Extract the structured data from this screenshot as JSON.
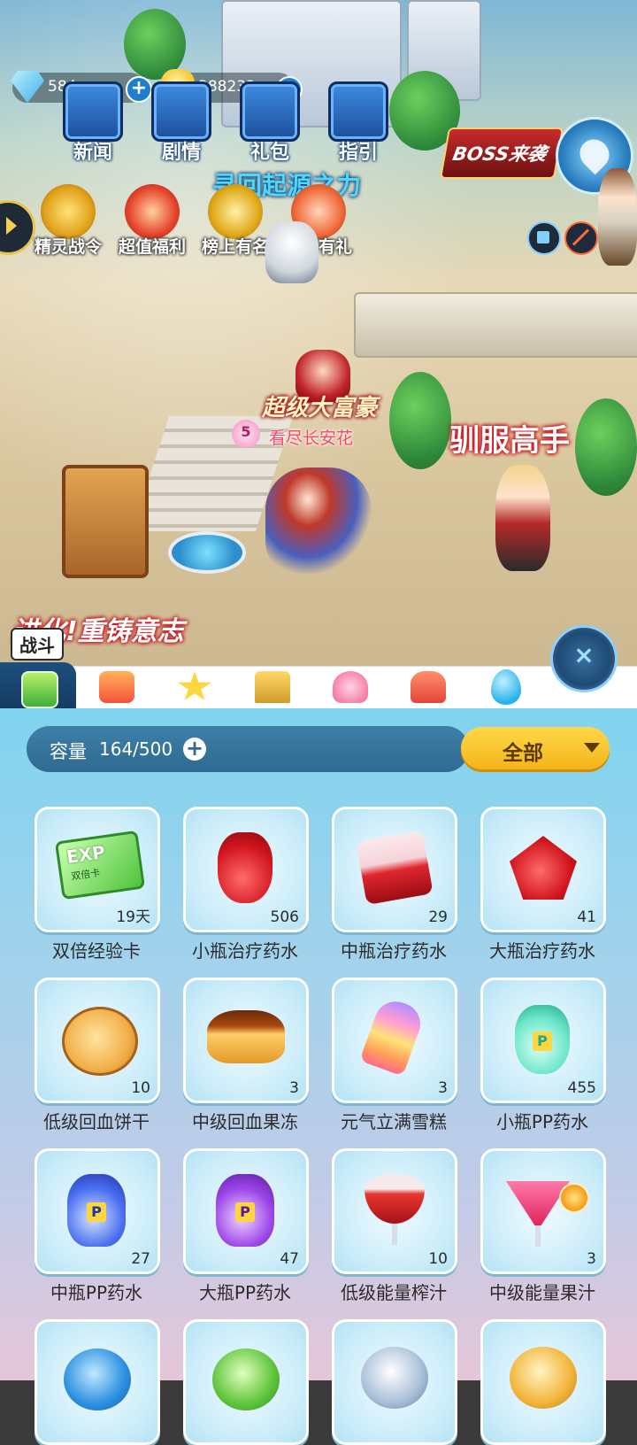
{
  "hud": {
    "gems": "584",
    "coins": "388232",
    "top_buttons": [
      {
        "label": "新闻"
      },
      {
        "label": "剧情"
      },
      {
        "label": "礼包"
      },
      {
        "label": "指引"
      }
    ],
    "event_buttons": [
      {
        "label": "精灵战令"
      },
      {
        "label": "超值福利"
      },
      {
        "label": "榜上有名"
      },
      {
        "label": "邀请有礼"
      }
    ],
    "boss_label": "BOSS来袭",
    "event_banner": "寻回起源之力"
  },
  "scene": {
    "player_title": "超级大富豪",
    "player_name": "看尽长安花",
    "player_level": "5",
    "tamer_banner": "驯服高手",
    "evolve_banner": "进化!重铸意志"
  },
  "tabs": {
    "active_label": "战斗"
  },
  "bag": {
    "capacity_label": "容量",
    "capacity_value": "164/500",
    "filter_label": "全部",
    "items": [
      {
        "name": "双倍经验卡",
        "count": "19天",
        "art": "exp-card",
        "art_text": "EXP",
        "art_sub": "双倍卡"
      },
      {
        "name": "小瓶治疗药水",
        "count": "506",
        "art": "potion-small-red"
      },
      {
        "name": "中瓶治疗药水",
        "count": "29",
        "art": "potion-medium-red"
      },
      {
        "name": "大瓶治疗药水",
        "count": "41",
        "art": "potion-large-red"
      },
      {
        "name": "低级回血饼干",
        "count": "10",
        "art": "cookie"
      },
      {
        "name": "中级回血果冻",
        "count": "3",
        "art": "pudding"
      },
      {
        "name": "元气立满雪糕",
        "count": "3",
        "art": "popsicle"
      },
      {
        "name": "小瓶PP药水",
        "count": "455",
        "art": "pp-potion-small",
        "art_text": "P"
      },
      {
        "name": "中瓶PP药水",
        "count": "27",
        "art": "pp-potion-medium",
        "art_text": "P"
      },
      {
        "name": "大瓶PP药水",
        "count": "47",
        "art": "pp-potion-large",
        "art_text": "P"
      },
      {
        "name": "低级能量榨汁",
        "count": "10",
        "art": "juice-glass"
      },
      {
        "name": "中级能量果汁",
        "count": "3",
        "art": "cocktail"
      }
    ]
  },
  "colors": {
    "panel_top": "#7fd3ee",
    "capacity_bar": "#2f6a92",
    "filter_button": "#f4b41a"
  }
}
